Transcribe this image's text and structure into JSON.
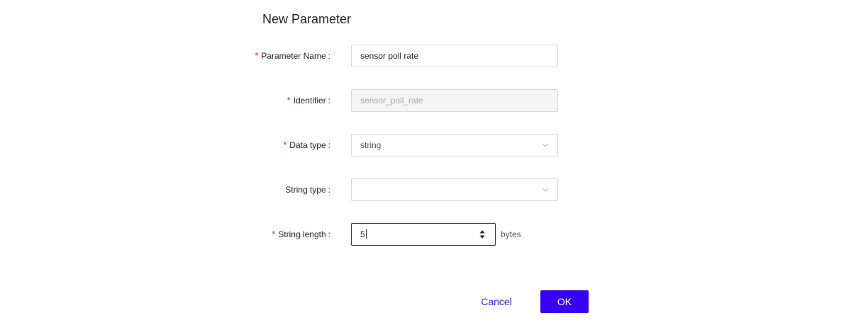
{
  "dialog": {
    "title": "New Parameter"
  },
  "form": {
    "required_mark": "*",
    "colon": ":",
    "parameter_name": {
      "label": "Parameter Name",
      "value": "sensor poll rate",
      "required": true
    },
    "identifier": {
      "label": "Identifier",
      "value": "sensor_poll_rate",
      "required": true,
      "disabled": true
    },
    "data_type": {
      "label": "Data type",
      "value": "string",
      "required": true
    },
    "string_type": {
      "label": "String type",
      "value": "",
      "required": false
    },
    "string_length": {
      "label": "String length",
      "value": "5",
      "unit": "bytes",
      "required": true
    }
  },
  "footer": {
    "cancel_label": "Cancel",
    "ok_label": "OK"
  },
  "colors": {
    "accent": "#3700f5",
    "required": "#f5222d",
    "focus_border": "#3b1bd6"
  },
  "icons": {
    "select_arrow": "chevron-down-icon",
    "number_stepper": "stepper-arrows-icon"
  }
}
